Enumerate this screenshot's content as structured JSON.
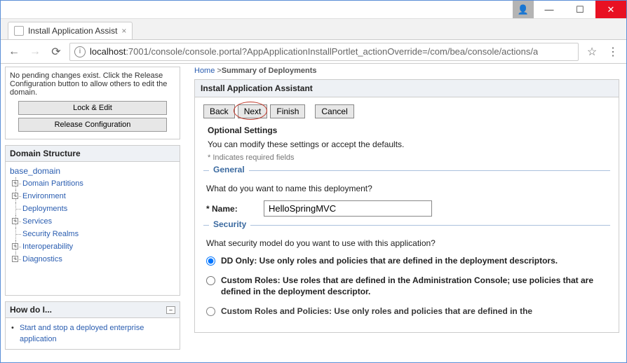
{
  "browser": {
    "tab_title": "Install Application Assist",
    "url_host": "localhost",
    "url_path": ":7001/console/console.portal?AppApplicationInstallPortlet_actionOverride=/com/bea/console/actions/a"
  },
  "change_center": {
    "note": "No pending changes exist. Click the Release Configuration button to allow others to edit the domain.",
    "lock_btn": "Lock & Edit",
    "release_btn": "Release Configuration"
  },
  "domain_structure": {
    "title": "Domain Structure",
    "root": "base_domain",
    "nodes": [
      {
        "label": "Domain Partitions",
        "expandable": true
      },
      {
        "label": "Environment",
        "expandable": true
      },
      {
        "label": "Deployments",
        "expandable": false
      },
      {
        "label": "Services",
        "expandable": true
      },
      {
        "label": "Security Realms",
        "expandable": false
      },
      {
        "label": "Interoperability",
        "expandable": true
      },
      {
        "label": "Diagnostics",
        "expandable": true
      }
    ]
  },
  "howdo": {
    "title": "How do I...",
    "items": [
      "Start and stop a deployed enterprise application"
    ]
  },
  "breadcrumb": {
    "home": "Home",
    "current": "Summary of Deployments"
  },
  "assistant": {
    "title": "Install Application Assistant",
    "buttons": {
      "back": "Back",
      "next": "Next",
      "finish": "Finish",
      "cancel": "Cancel"
    },
    "optional_heading": "Optional Settings",
    "optional_desc": "You can modify these settings or accept the defaults.",
    "required_note": "* Indicates required fields",
    "general": {
      "legend": "General",
      "question": "What do you want to name this deployment?",
      "name_label": "* Name:",
      "name_value": "HelloSpringMVC"
    },
    "security": {
      "legend": "Security",
      "question": "What security model do you want to use with this application?",
      "opt1": "DD Only: Use only roles and policies that are defined in the deployment descriptors.",
      "opt2": "Custom Roles: Use roles that are defined in the Administration Console; use policies that are defined in the deployment descriptor.",
      "opt3": "Custom Roles and Policies: Use only roles and policies that are defined in the"
    }
  }
}
